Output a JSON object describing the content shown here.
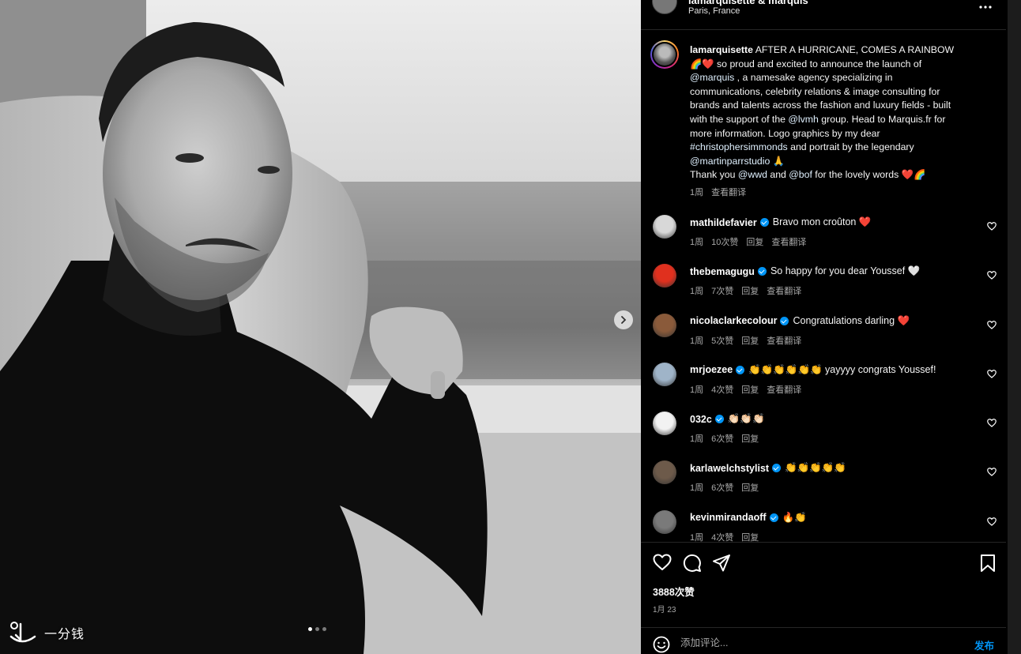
{
  "post_header": {
    "username": "lamarquisette & marquis",
    "location": "Paris, France",
    "more_icon": "more-horizontal-icon"
  },
  "photo": {
    "next_icon": "chevron-right-icon",
    "carousel_count": 3,
    "carousel_active": 1
  },
  "watermark": {
    "text": "一分钱"
  },
  "caption": {
    "username": "lamarquisette",
    "line1": " AFTER A HURRICANE, COMES A RAINBOW",
    "line2": "🌈❤️ so proud and excited to announce the launch of",
    "mention_marquis": "@marquis",
    "line3": " , a namesake agency specializing in",
    "line4": "communications, celebrity relations & image consulting for",
    "line5": "brands and talents across the fashion and luxury fields - built",
    "line6a": "with the support of the ",
    "mention_lvmh": "@lvmh",
    "line6b": " group. Head to Marquis.fr for",
    "line7": "more information. Logo graphics by my dear",
    "hashtag": "#christophersimmonds",
    "line8": " and portrait by the legendary",
    "mention_parr": "@martinparrstudio",
    "line9": " 🙏",
    "line10a": "Thank you ",
    "mention_wwd": "@wwd",
    "line10b": " and ",
    "mention_bof": "@bof",
    "line10c": " for the lovely words ❤️🌈",
    "time": "1周",
    "translate": "查看翻译"
  },
  "comments": [
    {
      "username": "mathildefavier",
      "verified": true,
      "text": "Bravo mon croûton ❤️",
      "time": "1周",
      "likes": "10次赞",
      "reply": "回复",
      "translate": "查看翻译",
      "avatar_color": "#d8d8d8"
    },
    {
      "username": "thebemagugu",
      "verified": true,
      "text": "So happy for you dear Youssef 🤍",
      "time": "1周",
      "likes": "7次赞",
      "reply": "回复",
      "translate": "查看翻译",
      "avatar_color": "#e0301e"
    },
    {
      "username": "nicolaclarkecolour",
      "verified": true,
      "text": "Congratulations darling ❤️",
      "time": "1周",
      "likes": "5次赞",
      "reply": "回复",
      "translate": "查看翻译",
      "avatar_color": "#8a5a3a"
    },
    {
      "username": "mrjoezee",
      "verified": true,
      "text": "👏👏👏👏👏👏 yayyyy congrats Youssef!",
      "time": "1周",
      "likes": "4次赞",
      "reply": "回复",
      "translate": "查看翻译",
      "avatar_color": "#9fb4c8"
    },
    {
      "username": "032c",
      "verified": true,
      "text": "👏🏻👏🏻👏🏻",
      "time": "1周",
      "likes": "6次赞",
      "reply": "回复",
      "translate": "",
      "avatar_color": "#f2f2f2"
    },
    {
      "username": "karlawelchstylist",
      "verified": true,
      "text": "👏👏👏👏👏",
      "time": "1周",
      "likes": "6次赞",
      "reply": "回复",
      "translate": "",
      "avatar_color": "#6d5a4a"
    },
    {
      "username": "kevinmirandaoff",
      "verified": true,
      "text": "🔥👏",
      "time": "1周",
      "likes": "4次赞",
      "reply": "回复",
      "translate": "",
      "avatar_color": "#7a7a7a"
    }
  ],
  "actions": {
    "like_icon": "heart-icon",
    "comment_icon": "comment-icon",
    "share_icon": "send-icon",
    "save_icon": "bookmark-icon",
    "likes": "3888次赞",
    "date": "1月 23"
  },
  "comment_box": {
    "emoji_icon": "smiley-icon",
    "placeholder": "添加评论...",
    "post_label": "发布"
  },
  "colors": {
    "link": "#e0f1ff",
    "post_button": "#0095f6",
    "verified": "#0095f6",
    "muted": "#a8a8a8"
  }
}
